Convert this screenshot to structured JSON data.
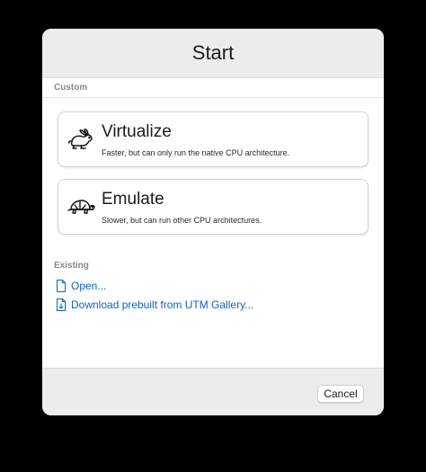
{
  "dialog": {
    "title": "Start"
  },
  "custom": {
    "label": "Custom",
    "options": [
      {
        "title": "Virtualize",
        "description": "Faster, but can only run the native CPU architecture.",
        "icon": "rabbit-icon"
      },
      {
        "title": "Emulate",
        "description": "Slower, but can run other CPU architectures.",
        "icon": "turtle-icon"
      }
    ]
  },
  "existing": {
    "label": "Existing",
    "links": [
      {
        "label": "Open...",
        "icon": "document-icon"
      },
      {
        "label": "Download prebuilt from UTM Gallery...",
        "icon": "download-document-icon"
      }
    ]
  },
  "footer": {
    "cancel_label": "Cancel"
  },
  "colors": {
    "link": "#0b65c8",
    "header_bg": "#ececec",
    "section_label": "#8a8a8a"
  }
}
